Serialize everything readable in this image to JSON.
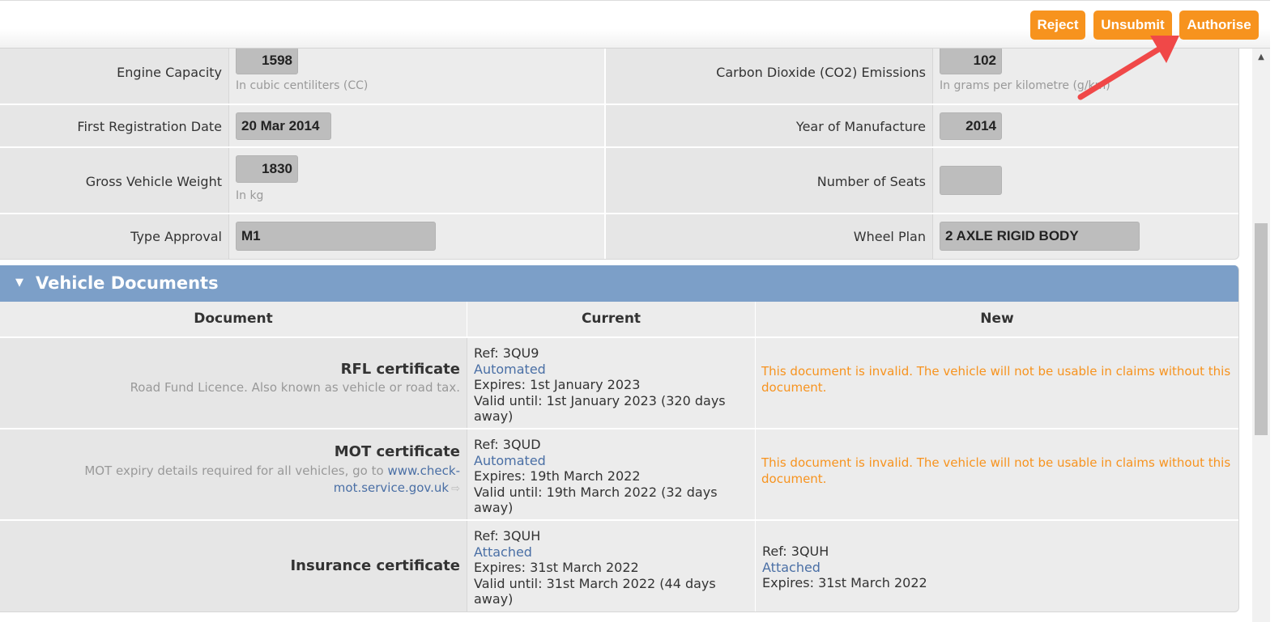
{
  "toolbar": {
    "reject_label": "Reject",
    "unsubmit_label": "Unsubmit",
    "authorise_label": "Authorise"
  },
  "specs": {
    "engine_capacity": {
      "label": "Engine Capacity",
      "value": "1598",
      "hint": "In cubic centiliters (CC)"
    },
    "co2_emissions": {
      "label": "Carbon Dioxide (CO2) Emissions",
      "value": "102",
      "hint": "In grams per kilometre (g/km)"
    },
    "first_registration_date": {
      "label": "First Registration Date",
      "value": "20 Mar 2014"
    },
    "year_of_manufacture": {
      "label": "Year of Manufacture",
      "value": "2014"
    },
    "gross_vehicle_weight": {
      "label": "Gross Vehicle Weight",
      "value": "1830",
      "hint": "In kg"
    },
    "number_of_seats": {
      "label": "Number of Seats",
      "value": ""
    },
    "type_approval": {
      "label": "Type Approval",
      "value": "M1"
    },
    "wheel_plan": {
      "label": "Wheel Plan",
      "value": "2 AXLE RIGID BODY"
    }
  },
  "documents": {
    "section_title": "Vehicle Documents",
    "columns": {
      "document": "Document",
      "current": "Current",
      "new": "New"
    },
    "rfl": {
      "name": "RFL certificate",
      "description": "Road Fund Licence. Also known as vehicle or road tax.",
      "current": {
        "ref": "Ref: 3QU9",
        "status": "Automated",
        "expires": "Expires: 1st January 2023",
        "valid_until": "Valid until: 1st January 2023 (320 days",
        "valid_until_2": "away)"
      },
      "new_warning": "This document is invalid. The vehicle will not be usable in claims without this document."
    },
    "mot": {
      "name": "MOT certificate",
      "description_prefix": "MOT expiry details required for all vehicles, go to",
      "link_text": "www.check-mot.service.gov.uk",
      "current": {
        "ref": "Ref: 3QUD",
        "status": "Automated",
        "expires": "Expires: 19th March 2022",
        "valid_until": "Valid until: 19th March 2022 (32 days",
        "valid_until_2": "away)"
      },
      "new_warning": "This document is invalid. The vehicle will not be usable in claims without this document."
    },
    "insurance": {
      "name": "Insurance certificate",
      "current": {
        "ref": "Ref: 3QUH",
        "status": "Attached",
        "expires": "Expires: 31st March 2022",
        "valid_until": "Valid until: 31st March 2022 (44 days",
        "valid_until_2": "away)"
      },
      "new": {
        "ref": "Ref: 3QUH",
        "status": "Attached",
        "expires": "Expires: 31st March 2022"
      }
    }
  },
  "colors": {
    "accent_orange": "#f7931e",
    "section_header_blue": "#7c9fc8",
    "link_blue": "#4a6fa5",
    "annotation_red": "#f04848"
  }
}
